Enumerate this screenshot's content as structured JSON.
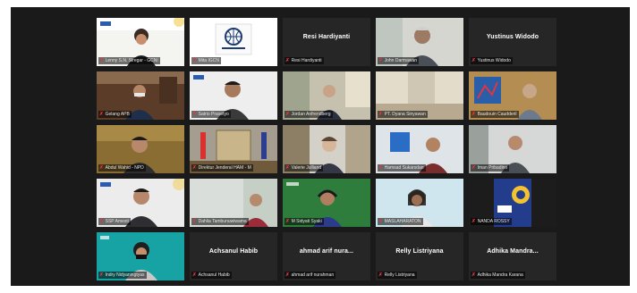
{
  "tiles": [
    {
      "label": "Lenny S.N. Siregar - GCNI",
      "video": true,
      "active": true,
      "bg": "#f3f3f3",
      "big": ""
    },
    {
      "label": "Mita IGCN",
      "video": true,
      "bg": "#ffffff",
      "big": ""
    },
    {
      "label": "Resi Hardiyanti",
      "video": false,
      "big": "Resi Hardiyanti"
    },
    {
      "label": "John Darmawan",
      "video": true,
      "bg": "#cfd2cc",
      "big": ""
    },
    {
      "label": "Yustinus Widodo",
      "video": false,
      "big": "Yustinus Widodo"
    },
    {
      "label": "Gelang APB",
      "video": true,
      "bg": "#6f4a30",
      "big": ""
    },
    {
      "label": "Satrio Prasetyo",
      "video": true,
      "bg": "#e8e8e8",
      "big": ""
    },
    {
      "label": "Jordan Anfrendberg",
      "video": true,
      "bg": "#c7c1b0",
      "big": ""
    },
    {
      "label": "PT. Dyana Sinyawan",
      "video": true,
      "bg": "#ddd5c4",
      "big": ""
    },
    {
      "label": "Baudouin Caudderil",
      "video": true,
      "bg": "#b48c4c",
      "big": ""
    },
    {
      "label": "Abdul Wahid - NPD",
      "video": true,
      "bg": "#8a6d32",
      "big": ""
    },
    {
      "label": "Direktur Jenderal HAM - M",
      "video": true,
      "bg": "#a6a093",
      "big": ""
    },
    {
      "label": "Valerie Julliand",
      "video": true,
      "bg": "#d6d3cc",
      "big": ""
    },
    {
      "label": "Hamsad Sukarsdan",
      "video": true,
      "bg": "#dfe4e8",
      "big": ""
    },
    {
      "label": "Iman Pribadino",
      "video": true,
      "bg": "#d7d9d8",
      "big": ""
    },
    {
      "label": "SSP Amesti",
      "video": true,
      "bg": "#e9e9e9",
      "big": ""
    },
    {
      "label": "Dahlia Tambunuwiwama",
      "video": true,
      "bg": "#c6cfc6",
      "big": ""
    },
    {
      "label": "M Sidyati Syaki",
      "video": true,
      "bg": "#2f7d3c",
      "big": ""
    },
    {
      "label": "MASLAHARATON",
      "video": true,
      "bg": "#cfe6ee",
      "big": ""
    },
    {
      "label": "NANDA ROSSY",
      "video": true,
      "bg": "#243c8c",
      "big": ""
    },
    {
      "label": "Indry Nidyaningtyas",
      "video": true,
      "bg": "#17a3a3",
      "big": ""
    },
    {
      "label": "Achsanul Habib",
      "video": false,
      "big": "Achsanul Habib"
    },
    {
      "label": "ahmad arif nurahman",
      "video": false,
      "big": "ahmad arif nura..."
    },
    {
      "label": "Relly Listriyana",
      "video": false,
      "big": "Relly Listriyana"
    },
    {
      "label": "Adhika Mandra Karana",
      "video": false,
      "big": "Adhika Mandra..."
    }
  ]
}
